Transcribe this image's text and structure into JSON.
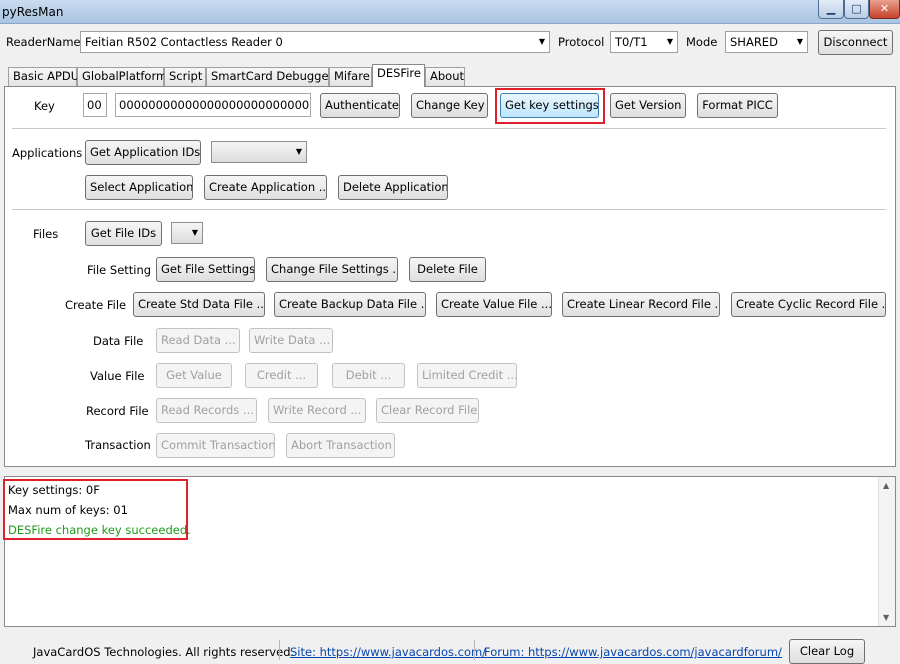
{
  "window": {
    "title": "pyResMan",
    "minimize": "▁",
    "maximize": "□",
    "close": "✕"
  },
  "topbar": {
    "reader_label": "ReaderName",
    "reader_value": "Feitian R502 Contactless Reader 0",
    "protocol_label": "Protocol",
    "protocol_value": "T0/T1",
    "mode_label": "Mode",
    "mode_value": "SHARED",
    "disconnect": "Disconnect"
  },
  "tabs": [
    "Basic APDU",
    "GlobalPlatform",
    "Script",
    "SmartCard Debugger",
    "Mifare",
    "DESFire",
    "About"
  ],
  "active_tab": "DESFire",
  "key": {
    "label": "Key",
    "key_no": "00",
    "key_value": "00000000000000000000000000000000",
    "authenticate": "Authenticate",
    "change_key": "Change Key",
    "get_key_settings": "Get key settings",
    "get_version": "Get Version",
    "format_picc": "Format PICC"
  },
  "applications": {
    "label": "Applications",
    "get_ids": "Get Application IDs",
    "select": "Select Application",
    "create": "Create Application ...",
    "delete": "Delete Application"
  },
  "files": {
    "label": "Files",
    "get_ids": "Get File IDs",
    "file_setting_label": "File Setting",
    "get_settings": "Get File Settings",
    "change_settings": "Change File Settings ...",
    "delete_file": "Delete File",
    "create_file_label": "Create File",
    "create_std": "Create Std Data File ...",
    "create_backup": "Create Backup Data File ...",
    "create_value": "Create Value File ...",
    "create_linear": "Create Linear Record File ...",
    "create_cyclic": "Create Cyclic Record File ...",
    "data_file_label": "Data File",
    "read_data": "Read Data ...",
    "write_data": "Write Data ...",
    "value_file_label": "Value File",
    "get_value": "Get Value",
    "credit": "Credit ...",
    "debit": "Debit ...",
    "limited_credit": "Limited Credit ...",
    "record_file_label": "Record File",
    "read_records": "Read Records ...",
    "write_record": "Write Record ...",
    "clear_record": "Clear Record File",
    "transaction_label": "Transaction",
    "commit": "Commit Transaction",
    "abort": "Abort Transaction"
  },
  "log": [
    {
      "text": "Key settings: 0F",
      "color": "#000000"
    },
    {
      "text": "Max num of keys: 01",
      "color": "#000000"
    },
    {
      "text": "DESFire change key succeeded.",
      "color": "#1e9a1e"
    }
  ],
  "status": {
    "copyright": "JavaCardOS Technologies. All rights reserved.",
    "site": "Site: https://www.javacardos.com/",
    "forum": "Forum: https://www.javacardos.com/javacardforum/",
    "clear_log": "Clear Log"
  },
  "colors": {
    "highlight_box": "#e0202a",
    "success_text": "#1e9a1e",
    "link": "#0645ad"
  }
}
